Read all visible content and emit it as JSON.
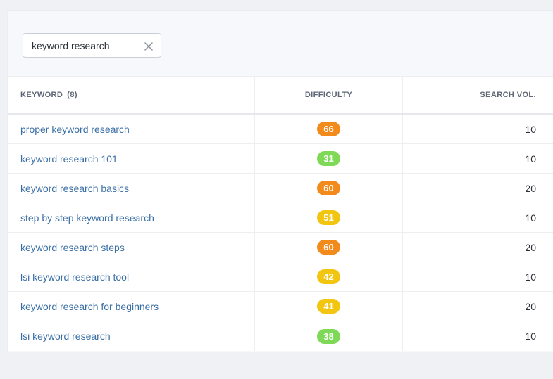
{
  "search": {
    "value": "keyword research",
    "clear_icon": "close-icon"
  },
  "table": {
    "headers": {
      "keyword": "KEYWORD",
      "keyword_count": "(8)",
      "difficulty": "DIFFICULTY",
      "search_volume": "SEARCH VOL."
    },
    "rows": [
      {
        "keyword": "proper keyword research",
        "difficulty": "66",
        "volume": "10",
        "difficulty_color": "#f28a1c"
      },
      {
        "keyword": "keyword research 101",
        "difficulty": "31",
        "volume": "10",
        "difficulty_color": "#7ed957"
      },
      {
        "keyword": "keyword research basics",
        "difficulty": "60",
        "volume": "20",
        "difficulty_color": "#f28a1c"
      },
      {
        "keyword": "step by step keyword research",
        "difficulty": "51",
        "volume": "10",
        "difficulty_color": "#f2c511"
      },
      {
        "keyword": "keyword research steps",
        "difficulty": "60",
        "volume": "20",
        "difficulty_color": "#f28a1c"
      },
      {
        "keyword": "lsi keyword research tool",
        "difficulty": "42",
        "volume": "10",
        "difficulty_color": "#f2c511"
      },
      {
        "keyword": "keyword research for beginners",
        "difficulty": "41",
        "volume": "20",
        "difficulty_color": "#f2c511"
      },
      {
        "keyword": "lsi keyword research",
        "difficulty": "38",
        "volume": "10",
        "difficulty_color": "#7ed957"
      }
    ]
  }
}
